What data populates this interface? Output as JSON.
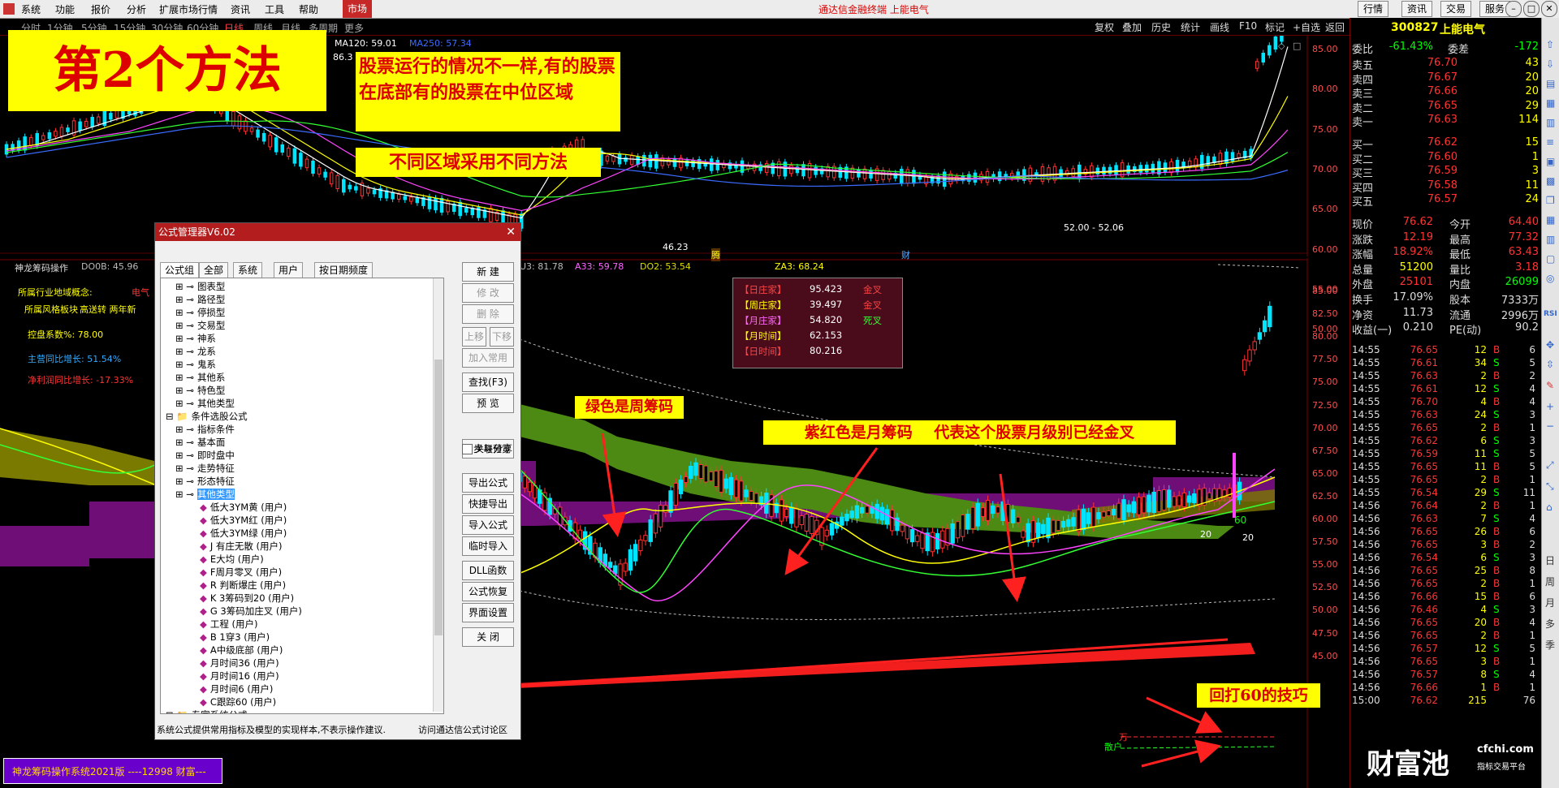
{
  "menubar": {
    "items": [
      "系统",
      "功能",
      "报价",
      "分析",
      "扩展市场行情",
      "资讯",
      "工具",
      "帮助"
    ],
    "market_tab": "市场",
    "app_title": "通达信金融终端 上能电气",
    "right_buttons": [
      "行情",
      "资讯",
      "交易",
      "服务"
    ]
  },
  "period_bar": {
    "periods": [
      "分时",
      "1分钟",
      "5分钟",
      "15分钟",
      "30分钟",
      "60分钟",
      "日线",
      "周线",
      "月线",
      "多周期",
      "更多"
    ],
    "active": "日线",
    "tools": [
      "复权",
      "叠加",
      "历史",
      "统计",
      "画线",
      "F10",
      "标记",
      "+自选",
      "返回"
    ]
  },
  "upper_chart": {
    "ma_labels": [
      {
        "text": "MA120: 59.01",
        "color": "#ffffff"
      },
      {
        "text": "MA250: 57.34",
        "color": "#3b6cff"
      }
    ],
    "price_axis": [
      "85.00",
      "80.00",
      "75.00",
      "70.00",
      "65.00",
      "60.00",
      "55.00",
      "50.00"
    ],
    "annotations": {
      "high": "86.3",
      "low": "46.23",
      "range": "52.00 - 52.06",
      "marker1": "腾",
      "marker2": "财"
    }
  },
  "lower_chart": {
    "indicator_name": "神龙筹码操作",
    "indicator_values": [
      {
        "text": "DO0B: 45.96",
        "color": "#bbbbbb"
      },
      {
        "text": "U3: 81.78",
        "color": "#bbbbbb"
      },
      {
        "text": "A33: 59.78",
        "color": "#ff66ff"
      },
      {
        "text": "DO2: 53.54",
        "color": "#dddd00"
      },
      {
        "text": "ZA3: 68.24",
        "color": "#ffff00"
      }
    ],
    "info_lines": [
      {
        "text": "所属行业地域概念:",
        "color": "#ffff00"
      },
      {
        "text": "电气",
        "color": "#ff3333"
      },
      {
        "text": "所属风格板块",
        "color": "#ffff00"
      },
      {
        "text": "高送转 两年新",
        "color": "#ffff00"
      },
      {
        "text": "控盘系数%: 78.00",
        "color": "#ffff00"
      },
      {
        "text": "主营同比增长: 51.54%",
        "color": "#33aaff"
      },
      {
        "text": "净利润同比增长: -17.33%",
        "color": "#ff3333"
      }
    ],
    "price_axis": [
      "85.00",
      "82.50",
      "80.00",
      "77.50",
      "75.00",
      "72.50",
      "70.00",
      "67.50",
      "65.00",
      "62.50",
      "60.00",
      "57.50",
      "55.00",
      "52.50",
      "50.00",
      "47.50",
      "45.00"
    ],
    "zhuangjia_table": [
      {
        "label": "【日庄家】",
        "value": "95.423",
        "status": "金叉",
        "label_color": "#ff4444",
        "status_color": "#ff4444"
      },
      {
        "label": "【周庄家】",
        "value": "39.497",
        "status": "金叉",
        "label_color": "#ffff00",
        "status_color": "#ff4444"
      },
      {
        "label": "【月庄家】",
        "value": "54.820",
        "status": "死叉",
        "label_color": "#ff66ff",
        "status_color": "#33ff33"
      },
      {
        "label": "【月时间】",
        "value": "62.153",
        "status": "",
        "label_color": "#ffff00",
        "status_color": "#ffffff"
      },
      {
        "label": "【日时间】",
        "value": "80.216",
        "status": "",
        "label_color": "#ff4444",
        "status_color": "#ffffff"
      }
    ],
    "markers": {
      "sixty": "60",
      "twenty_a": "20",
      "twenty_b": "20",
      "wan1": "万",
      "wan2": "散户"
    },
    "bottom_banner": "神龙筹码操作系统2021版 ----12998 财富---"
  },
  "callouts": {
    "method_title": "第2个方法",
    "text1": "股票运行的情况不一样,有的股票在底部有的股票在中位区域",
    "text2": "不同区域采用不同方法",
    "text3": "绿色是周筹码",
    "text4": "紫红色是月筹码    代表这个股票月级别已经金叉",
    "text5": "回打60的技巧"
  },
  "dialog": {
    "title": "公式管理器V6.02",
    "tabs": [
      "公式组",
      "全部",
      "系统",
      "用户",
      "按日期频度"
    ],
    "tree": [
      {
        "level": 1,
        "label": "图表型",
        "kind": "group"
      },
      {
        "level": 1,
        "label": "路径型",
        "kind": "group"
      },
      {
        "level": 1,
        "label": "停损型",
        "kind": "group"
      },
      {
        "level": 1,
        "label": "交易型",
        "kind": "group"
      },
      {
        "level": 1,
        "label": "神系",
        "kind": "group"
      },
      {
        "level": 1,
        "label": "龙系",
        "kind": "group"
      },
      {
        "level": 1,
        "label": "鬼系",
        "kind": "group"
      },
      {
        "level": 1,
        "label": "其他系",
        "kind": "group"
      },
      {
        "level": 1,
        "label": "特色型",
        "kind": "group"
      },
      {
        "level": 1,
        "label": "其他类型",
        "kind": "group"
      },
      {
        "level": 0,
        "label": "条件选股公式",
        "kind": "folder"
      },
      {
        "level": 1,
        "label": "指标条件",
        "kind": "group"
      },
      {
        "level": 1,
        "label": "基本面",
        "kind": "group"
      },
      {
        "level": 1,
        "label": "即时盘中",
        "kind": "group"
      },
      {
        "level": 1,
        "label": "走势特征",
        "kind": "group"
      },
      {
        "level": 1,
        "label": "形态特征",
        "kind": "group"
      },
      {
        "level": 1,
        "label": "其他类型",
        "kind": "group-selected"
      },
      {
        "level": 2,
        "label": "低大3YM黄    (用户)",
        "kind": "leaf"
      },
      {
        "level": 2,
        "label": "低大3YM红    (用户)",
        "kind": "leaf"
      },
      {
        "level": 2,
        "label": "低大3YM绿    (用户)",
        "kind": "leaf"
      },
      {
        "level": 2,
        "label": "J  有庄无散    (用户)",
        "kind": "leaf"
      },
      {
        "level": 2,
        "label": "E大均    (用户)",
        "kind": "leaf"
      },
      {
        "level": 2,
        "label": "F周月零叉    (用户)",
        "kind": "leaf"
      },
      {
        "level": 2,
        "label": "R  判断爆庄    (用户)",
        "kind": "leaf"
      },
      {
        "level": 2,
        "label": "K 3筹码到20    (用户)",
        "kind": "leaf"
      },
      {
        "level": 2,
        "label": "G 3筹码加庄叉    (用户)",
        "kind": "leaf"
      },
      {
        "level": 2,
        "label": "工程    (用户)",
        "kind": "leaf"
      },
      {
        "level": 2,
        "label": "B 1穿3    (用户)",
        "kind": "leaf"
      },
      {
        "level": 2,
        "label": "A中级底部    (用户)",
        "kind": "leaf"
      },
      {
        "level": 2,
        "label": "月时间36    (用户)",
        "kind": "leaf"
      },
      {
        "level": 2,
        "label": "月时间16    (用户)",
        "kind": "leaf"
      },
      {
        "level": 2,
        "label": "月时间6    (用户)",
        "kind": "leaf"
      },
      {
        "level": 2,
        "label": "C跟踪60    (用户)",
        "kind": "leaf"
      },
      {
        "level": 0,
        "label": "专家系统公式",
        "kind": "folder"
      }
    ],
    "buttons": [
      {
        "label": "新  建",
        "disabled": false
      },
      {
        "label": "修  改",
        "disabled": true
      },
      {
        "label": "删  除",
        "disabled": true
      },
      {
        "label": "上移",
        "disabled": true
      },
      {
        "label": "下移",
        "disabled": true
      },
      {
        "label": "加入常用",
        "disabled": true
      },
      {
        "label": "查找(F3)",
        "disabled": false
      },
      {
        "label": "预  览",
        "disabled": false
      },
      {
        "label": "同步与分享",
        "disabled": false
      },
      {
        "label": "导出公式",
        "disabled": false
      },
      {
        "label": "快捷导出",
        "disabled": false
      },
      {
        "label": "导入公式",
        "disabled": false
      },
      {
        "label": "临时导入",
        "disabled": false
      },
      {
        "label": "DLL函数",
        "disabled": false
      },
      {
        "label": "公式恢复",
        "disabled": false
      },
      {
        "label": "界面设置",
        "disabled": false
      },
      {
        "label": "关  闭",
        "disabled": false
      }
    ],
    "checkbox_label": "关联预览",
    "status_text": "系统公式提供常用指标及模型的实现样本,不表示操作建议.",
    "forum_link": "访问通达信公式讨论区"
  },
  "quote_panel": {
    "code": "300827",
    "name": "上能电气",
    "weibi": {
      "label": "委比",
      "value": "-61.43%",
      "label2": "委差",
      "value2": "-172"
    },
    "asks": [
      {
        "label": "卖五",
        "price": "76.70",
        "vol": "43"
      },
      {
        "label": "卖四",
        "price": "76.67",
        "vol": "20"
      },
      {
        "label": "卖三",
        "price": "76.66",
        "vol": "20"
      },
      {
        "label": "卖二",
        "price": "76.65",
        "vol": "29"
      },
      {
        "label": "卖一",
        "price": "76.63",
        "vol": "114"
      }
    ],
    "bids": [
      {
        "label": "买一",
        "price": "76.62",
        "vol": "15"
      },
      {
        "label": "买二",
        "price": "76.60",
        "vol": "1"
      },
      {
        "label": "买三",
        "price": "76.59",
        "vol": "3"
      },
      {
        "label": "买四",
        "price": "76.58",
        "vol": "11"
      },
      {
        "label": "买五",
        "price": "76.57",
        "vol": "24"
      }
    ],
    "stats": [
      {
        "l1": "现价",
        "v1": "76.62",
        "l2": "今开",
        "v2": "64.40"
      },
      {
        "l1": "涨跌",
        "v1": "12.19",
        "l2": "最高",
        "v2": "77.32"
      },
      {
        "l1": "涨幅",
        "v1": "18.92%",
        "l2": "最低",
        "v2": "63.43"
      },
      {
        "l1": "总量",
        "v1": "51200",
        "l2": "量比",
        "v2": "3.18"
      },
      {
        "l1": "外盘",
        "v1": "25101",
        "l2": "内盘",
        "v2": "26099"
      },
      {
        "l1": "换手",
        "v1": "17.09%",
        "l2": "股本",
        "v2": "7333万"
      },
      {
        "l1": "净资",
        "v1": "11.73",
        "l2": "流通",
        "v2": "2996万"
      },
      {
        "l1": "收益(一)",
        "v1": "0.210",
        "l2": "PE(动)",
        "v2": "90.2"
      }
    ],
    "ticks": [
      {
        "time": "14:55",
        "price": "76.65",
        "vol": "12",
        "bs": "B",
        "n": "6"
      },
      {
        "time": "14:55",
        "price": "76.61",
        "vol": "34",
        "bs": "S",
        "n": "5"
      },
      {
        "time": "14:55",
        "price": "76.63",
        "vol": "2",
        "bs": "B",
        "n": "2"
      },
      {
        "time": "14:55",
        "price": "76.61",
        "vol": "12",
        "bs": "S",
        "n": "4"
      },
      {
        "time": "14:55",
        "price": "76.70",
        "vol": "4",
        "bs": "B",
        "n": "4"
      },
      {
        "time": "14:55",
        "price": "76.63",
        "vol": "24",
        "bs": "S",
        "n": "3"
      },
      {
        "time": "14:55",
        "price": "76.65",
        "vol": "2",
        "bs": "B",
        "n": "1"
      },
      {
        "time": "14:55",
        "price": "76.62",
        "vol": "6",
        "bs": "S",
        "n": "3"
      },
      {
        "time": "14:55",
        "price": "76.59",
        "vol": "11",
        "bs": "S",
        "n": "5"
      },
      {
        "time": "14:55",
        "price": "76.65",
        "vol": "11",
        "bs": "B",
        "n": "5"
      },
      {
        "time": "14:55",
        "price": "76.65",
        "vol": "2",
        "bs": "B",
        "n": "1"
      },
      {
        "time": "14:55",
        "price": "76.54",
        "vol": "29",
        "bs": "S",
        "n": "11"
      },
      {
        "time": "14:56",
        "price": "76.64",
        "vol": "2",
        "bs": "B",
        "n": "1"
      },
      {
        "time": "14:56",
        "price": "76.63",
        "vol": "7",
        "bs": "S",
        "n": "4"
      },
      {
        "time": "14:56",
        "price": "76.65",
        "vol": "26",
        "bs": "B",
        "n": "6"
      },
      {
        "time": "14:56",
        "price": "76.65",
        "vol": "3",
        "bs": "B",
        "n": "2"
      },
      {
        "time": "14:56",
        "price": "76.54",
        "vol": "6",
        "bs": "S",
        "n": "3"
      },
      {
        "time": "14:56",
        "price": "76.65",
        "vol": "25",
        "bs": "B",
        "n": "8"
      },
      {
        "time": "14:56",
        "price": "76.65",
        "vol": "2",
        "bs": "B",
        "n": "1"
      },
      {
        "time": "14:56",
        "price": "76.66",
        "vol": "15",
        "bs": "B",
        "n": "6"
      },
      {
        "time": "14:56",
        "price": "76.46",
        "vol": "4",
        "bs": "S",
        "n": "3"
      },
      {
        "time": "14:56",
        "price": "76.65",
        "vol": "20",
        "bs": "B",
        "n": "4"
      },
      {
        "time": "14:56",
        "price": "76.65",
        "vol": "2",
        "bs": "B",
        "n": "1"
      },
      {
        "time": "14:56",
        "price": "76.57",
        "vol": "12",
        "bs": "S",
        "n": "5"
      },
      {
        "time": "14:56",
        "price": "76.65",
        "vol": "3",
        "bs": "B",
        "n": "1"
      },
      {
        "time": "14:56",
        "price": "76.57",
        "vol": "8",
        "bs": "S",
        "n": "4"
      },
      {
        "time": "14:56",
        "price": "76.66",
        "vol": "1",
        "bs": "B",
        "n": "1"
      },
      {
        "time": "15:00",
        "price": "76.62",
        "vol": "215",
        "bs": "",
        "n": "76"
      }
    ],
    "watermark": {
      "brand": "财富池",
      "site": "cfchi.com",
      "tagline": "指标交易平台"
    }
  },
  "sidebar": {
    "labels": [
      "RSI",
      "日",
      "周",
      "月",
      "多",
      "季"
    ]
  },
  "colors": {
    "up": "#ff3333",
    "down": "#00e5ff",
    "month_chip": "#6e0e76",
    "week_chip": "#4c8a14",
    "callout_bg": "#ffff00",
    "callout_fg": "#dd0000",
    "dialog_title": "#b31d1d"
  }
}
